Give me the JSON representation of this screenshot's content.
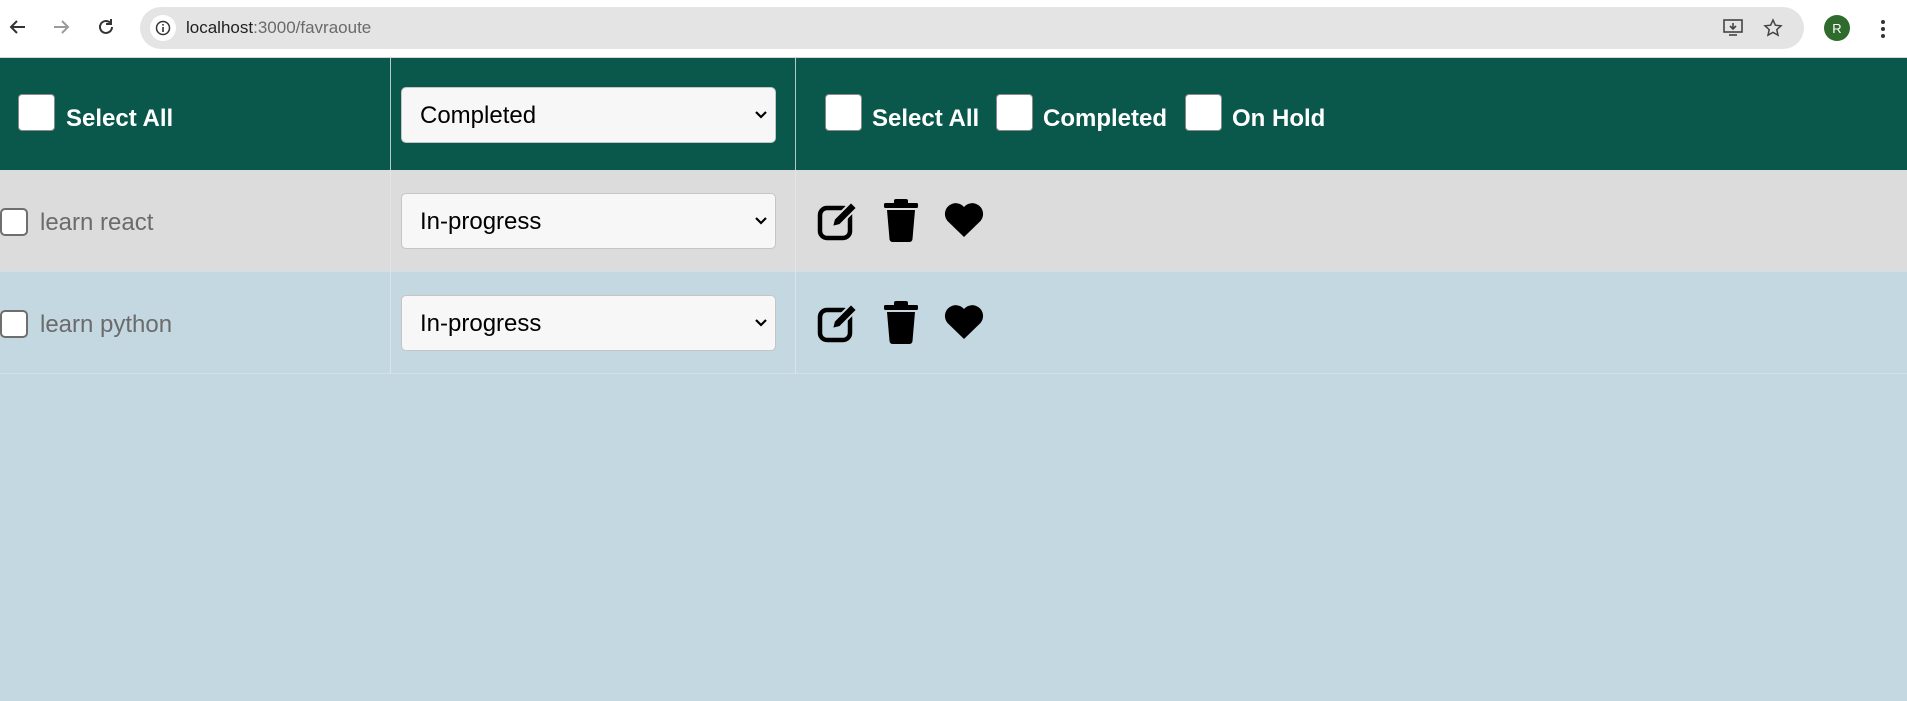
{
  "browser": {
    "url_host": "localhost",
    "url_path": ":3000/favraoute",
    "profile_initial": "R",
    "icons": [
      "back-arrow-icon",
      "forward-arrow-icon",
      "reload-icon",
      "info-icon",
      "install-app-icon",
      "star-icon",
      "more-vert-icon"
    ]
  },
  "header": {
    "select_all_label": "Select All",
    "status_select_value": "Completed",
    "filter_select_all_label": "Select All",
    "filter_completed_label": "Completed",
    "filter_on_hold_label": "On Hold"
  },
  "tasks": [
    {
      "title": "learn react",
      "status": "In-progress"
    },
    {
      "title": "learn python",
      "status": "In-progress"
    }
  ],
  "actions": [
    "edit-icon",
    "trash-icon",
    "heart-icon"
  ],
  "colors": {
    "header_bg": "#0a584c",
    "row_odd_bg": "#dcdcdc",
    "page_bg": "#c4d8e2"
  }
}
